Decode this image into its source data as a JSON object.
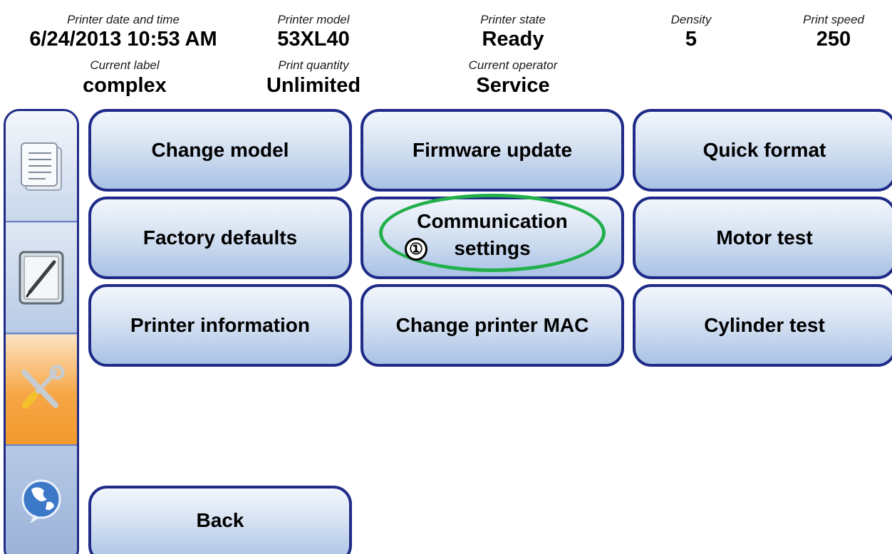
{
  "header": {
    "date_time": {
      "caption": "Printer date and time",
      "value": "6/24/2013 10:53 AM"
    },
    "model": {
      "caption": "Printer model",
      "value": "53XL40"
    },
    "state": {
      "caption": "Printer state",
      "value": "Ready"
    },
    "density": {
      "caption": "Density",
      "value": "5"
    },
    "speed": {
      "caption": "Print speed",
      "value": "250"
    },
    "label": {
      "caption": "Current label",
      "value": "complex"
    },
    "quantity": {
      "caption": "Print quantity",
      "value": "Unlimited"
    },
    "operator": {
      "caption": "Current operator",
      "value": "Service"
    }
  },
  "sidebar": {
    "items": [
      {
        "icon": "document-list-icon",
        "active": false
      },
      {
        "icon": "pen-edit-icon",
        "active": false
      },
      {
        "icon": "tools-icon",
        "active": true,
        "active_color": "#f39a2d"
      },
      {
        "icon": "globe-icon",
        "active": false
      }
    ]
  },
  "buttons": {
    "change_model": "Change model",
    "firmware_update": "Firmware update",
    "quick_format": "Quick format",
    "factory_defaults": "Factory defaults",
    "communication_settings_line1": "Communication",
    "communication_settings_line2": "settings",
    "motor_test": "Motor test",
    "printer_information": "Printer information",
    "change_printer_mac": "Change printer MAC",
    "cylinder_test": "Cylinder test",
    "back": "Back"
  },
  "annotation": {
    "marker": "①",
    "highlight_color": "#22b04b"
  },
  "colors": {
    "border": "#1f2b87",
    "button_gradient_top": "#f2f6fc",
    "button_gradient_bottom": "#a9c2e5"
  }
}
